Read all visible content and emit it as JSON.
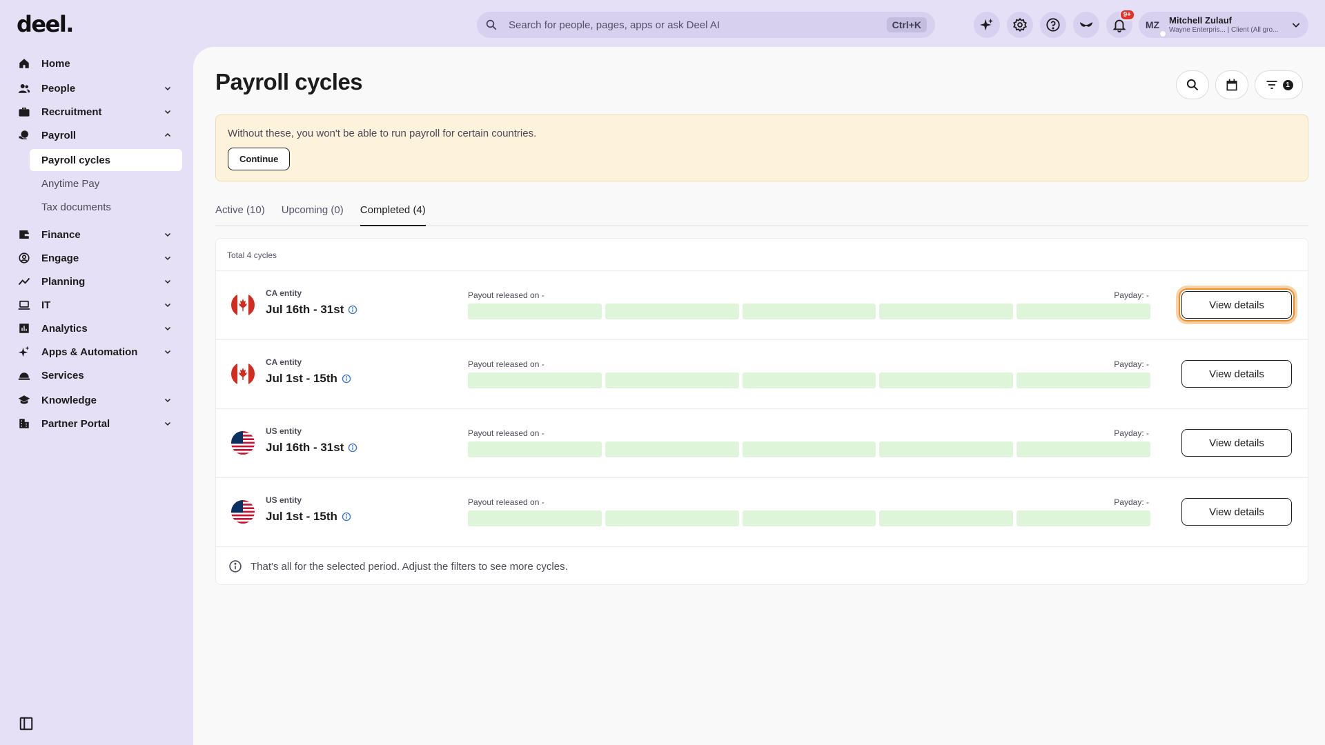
{
  "app": {
    "logo": "deel."
  },
  "search": {
    "placeholder": "Search for people, pages, apps or ask Deel AI",
    "shortcut": "Ctrl+K"
  },
  "topbar": {
    "icons": [
      "sparkle-icon",
      "gear-icon",
      "help-icon",
      "mask-icon",
      "bell-icon"
    ],
    "notification_count": "9+"
  },
  "user": {
    "initials": "MZ",
    "name": "Mitchell Zulauf",
    "subtitle": "Wayne Enterpris... | Client (All gro..."
  },
  "sidebar": {
    "items": [
      {
        "label": "Home",
        "icon": "home-icon",
        "expandable": false
      },
      {
        "label": "People",
        "icon": "people-icon",
        "expandable": true
      },
      {
        "label": "Recruitment",
        "icon": "briefcase-icon",
        "expandable": true
      },
      {
        "label": "Payroll",
        "icon": "payroll-icon",
        "expandable": true,
        "expanded": true
      },
      {
        "label": "Finance",
        "icon": "wallet-icon",
        "expandable": true
      },
      {
        "label": "Engage",
        "icon": "engage-icon",
        "expandable": true
      },
      {
        "label": "Planning",
        "icon": "trend-icon",
        "expandable": true
      },
      {
        "label": "IT",
        "icon": "laptop-icon",
        "expandable": true
      },
      {
        "label": "Analytics",
        "icon": "chart-icon",
        "expandable": true
      },
      {
        "label": "Apps & Automation",
        "icon": "sparkle-icon",
        "expandable": true
      },
      {
        "label": "Services",
        "icon": "bell-service-icon",
        "expandable": false
      },
      {
        "label": "Knowledge",
        "icon": "graduation-icon",
        "expandable": true
      },
      {
        "label": "Partner Portal",
        "icon": "building-icon",
        "expandable": true
      }
    ],
    "payroll_sub": [
      "Payroll cycles",
      "Anytime Pay",
      "Tax documents"
    ]
  },
  "main": {
    "title": "Payroll cycles",
    "filter_count": "1",
    "banner": {
      "text": "Without these, you won't be able to run payroll for certain countries.",
      "button": "Continue"
    },
    "tabs": [
      "Active (10)",
      "Upcoming (0)",
      "Completed (4)"
    ],
    "active_tab": 2,
    "total_label": "Total 4 cycles",
    "cycles": [
      {
        "entity": "CA entity",
        "period": "Jul 16th - 31st",
        "flag": "canada",
        "payout": "Payout released on -",
        "payday": "Payday: -",
        "button": "View details"
      },
      {
        "entity": "CA entity",
        "period": "Jul 1st - 15th",
        "flag": "canada",
        "payout": "Payout released on -",
        "payday": "Payday: -",
        "button": "View details"
      },
      {
        "entity": "US entity",
        "period": "Jul 16th - 31st",
        "flag": "usa",
        "payout": "Payout released on -",
        "payday": "Payday: -",
        "button": "View details"
      },
      {
        "entity": "US entity",
        "period": "Jul 1st - 15th",
        "flag": "usa",
        "payout": "Payout released on -",
        "payday": "Payday: -",
        "button": "View details"
      }
    ],
    "footer_note": "That's all for the selected period. Adjust the filters to see more cycles."
  },
  "colors": {
    "accent_bg": "#e6e0f6",
    "progress": "#dff5da",
    "focus_ring": "#f08a24",
    "banner_bg": "#fdf2dc"
  }
}
